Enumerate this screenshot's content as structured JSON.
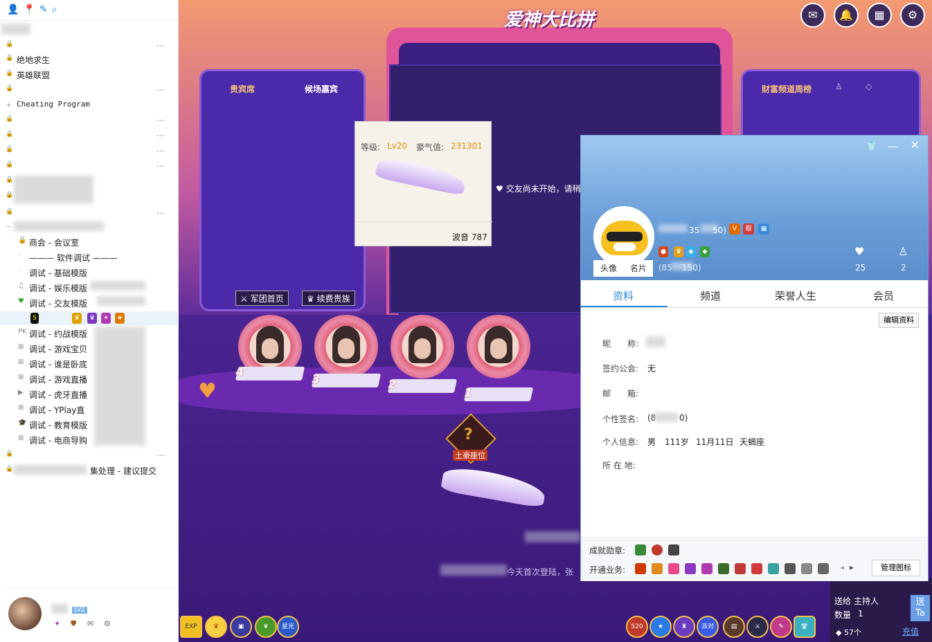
{
  "sidebar": {
    "tree": [
      {
        "label": "绝地求生"
      },
      {
        "label": "英雄联盟"
      },
      {
        "label": "Cheating Program"
      },
      {
        "label": "商会 - 会议室"
      },
      {
        "label": "——— 软件调试 ———"
      },
      {
        "label": "调试 - 基础模版"
      },
      {
        "label": "调试 - 娱乐模版"
      },
      {
        "label": "调试 - 交友模版"
      },
      {
        "label": "调试 - 约战模版"
      },
      {
        "label": "调试 - 游戏宝贝"
      },
      {
        "label": "调试 - 谁是卧底"
      },
      {
        "label": "调试 - 游戏直播"
      },
      {
        "label": "调试 - 虎牙直播"
      },
      {
        "label": "调试 - YPlay直"
      },
      {
        "label": "调试 - 教育模版"
      },
      {
        "label": "调试 - 电商导购"
      },
      {
        "label": "集处理 - 建议提交"
      }
    ],
    "dots": "...",
    "user_level": "LV2"
  },
  "stage": {
    "title": "爱神大比拼",
    "left_tabs": [
      "贵宾席",
      "候场嘉宾"
    ],
    "right_tab": "财富频道周榜",
    "buttons": [
      "军团首页",
      "续费贵族"
    ],
    "seat_numbers": [
      "4",
      "3",
      "2",
      "1"
    ],
    "tycoon_seat": "土豪座位",
    "notice": "交友尚未开始，请稍",
    "chat_line": "今天首次登陆，张",
    "popup_card": {
      "level_label": "等级:",
      "level_value": "Lv20",
      "wealth_label": "豪气值:",
      "wealth_value": "231301",
      "wave_label": "波音 787"
    },
    "send": {
      "send_to_label": "送给",
      "send_to_value": "主持人",
      "qty_label": "数量",
      "qty_value": "1",
      "send_btn": "送 Ta",
      "gift_count": "57个",
      "recharge": "充值"
    },
    "bottom_icons_right": [
      "520",
      "派对"
    ],
    "bottom_icons_left": [
      "EXP",
      "星光"
    ]
  },
  "profile": {
    "id_text_a": "35",
    "id_text_b": "50)",
    "id_sub_a": "(85",
    "id_sub_b": "150)",
    "avatar_btn": "头像",
    "card_btn": "名片",
    "likes": "25",
    "fans": "2",
    "tabs": [
      "资料",
      "频道",
      "荣誉人生",
      "会员"
    ],
    "edit_btn": "编辑资料",
    "fields": {
      "nick_label": "昵　　称:",
      "guild_label": "签约公会:",
      "guild_value": "无",
      "mail_label": "邮　　箱:",
      "sign_label": "个性签名:",
      "sign_value_a": "(8",
      "sign_value_b": "0)",
      "info_label": "个人信息:",
      "gender": "男",
      "age": "111岁",
      "birthday": "11月11日",
      "zodiac": "天蝎座",
      "location_label": "所 在 地:"
    },
    "achieve_label": "成就勋章:",
    "service_label": "开通业务:",
    "manage_btn": "管理图标",
    "colors": {
      "accent": "#2a88d8",
      "header_top": "#9ec8ee"
    }
  }
}
